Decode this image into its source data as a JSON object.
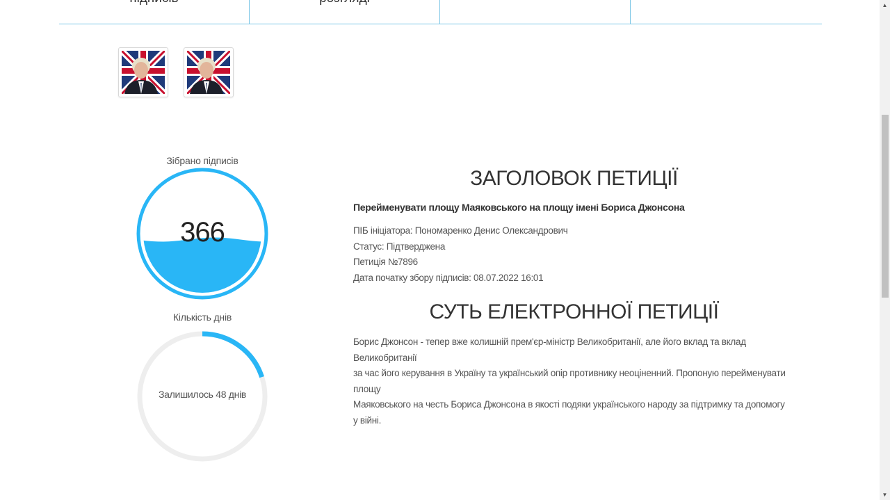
{
  "tabs": [
    {
      "label": "підписів"
    },
    {
      "label": "розгляді"
    },
    {
      "label": ""
    },
    {
      "label": ""
    }
  ],
  "images": [
    {
      "icon": "boris-johnson-photo"
    },
    {
      "icon": "boris-johnson-photo"
    }
  ],
  "signatures": {
    "title": "Зібрано підписів",
    "count": "366",
    "fill_fraction": 0.45,
    "color": "#29b6f6"
  },
  "days": {
    "title": "Кількість днів",
    "remaining_label": "Залишилось 48 днів",
    "progress_fraction": 0.2,
    "color": "#29b6f6",
    "track_color": "#eeeeee"
  },
  "petition": {
    "heading": "ЗАГОЛОВОК ПЕТИЦІЇ",
    "name": "Перейменувати площу Маяковського на площу імені Бориса Джонсона",
    "initiator": "ПІБ ініціатора: Пономаренко Денис Олександрович",
    "status": "Статус: Підтверджена",
    "number": "Петиція №7896",
    "start_date": "Дата початку збору підписів: 08.07.2022 16:01"
  },
  "essence": {
    "heading": "СУТЬ ЕЛЕКТРОННОЇ ПЕТИЦІЇ",
    "lines": [
      "Борис Джонсон - тепер вже колишній прем'єр-міністр Великобританії, але його вклад та вклад Великобританії",
      "за час його керування в Україну та український опір противнику неоціненний. Пропоную перейменувати площу",
      "Маяковського на честь Бориса Джонсона в якості подяки українського народу за підтримку та допомогу у війні."
    ]
  }
}
